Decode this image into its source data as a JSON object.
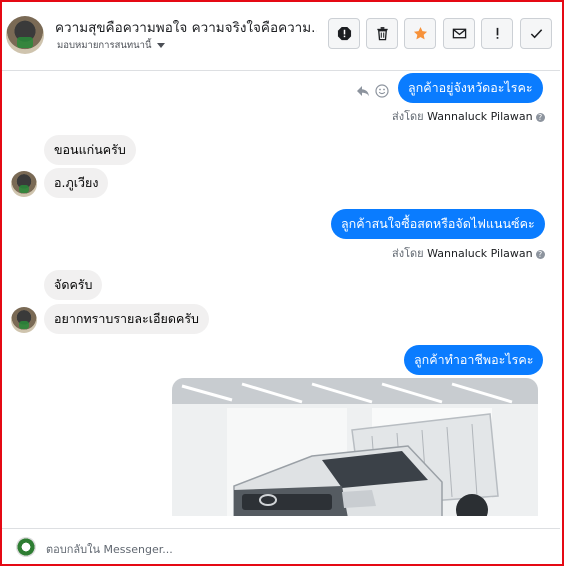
{
  "header": {
    "title": "ความสุขคือความพอใจ ความจริงใจคือความ...",
    "subtitle": "มอบหมายการสนทนานี้",
    "buttons": [
      {
        "name": "spam-icon"
      },
      {
        "name": "delete-icon"
      },
      {
        "name": "star-icon"
      },
      {
        "name": "unread-icon"
      },
      {
        "name": "important-icon"
      },
      {
        "name": "done-icon"
      }
    ]
  },
  "messages": {
    "m1": {
      "text": "ลูกค้าอยู่จังหวัดอะไรคะ",
      "sender_prefix": "ส่งโดย",
      "sender": "Wannaluck Pilawan"
    },
    "m2": {
      "text": "ขอนแก่นครับ"
    },
    "m3": {
      "text": "อ.ภูเวียง"
    },
    "m4": {
      "text": "ลูกค้าสนใจซื้อสดหรือจัดไฟแนนซ์คะ",
      "sender_prefix": "ส่งโดย",
      "sender": "Wannaluck Pilawan"
    },
    "m5": {
      "text": "จัดครับ"
    },
    "m6": {
      "text": "อยากทราบรายละเอียดครับ"
    },
    "m7": {
      "text": "ลูกค้าทำอาชีพอะไรคะ"
    }
  },
  "footer": {
    "placeholder": "ตอบกลับใน Messenger..."
  },
  "colors": {
    "accent": "#0a7cff",
    "incoming": "#f1f0f0",
    "star": "#f7923a",
    "frame": "#e50914"
  }
}
